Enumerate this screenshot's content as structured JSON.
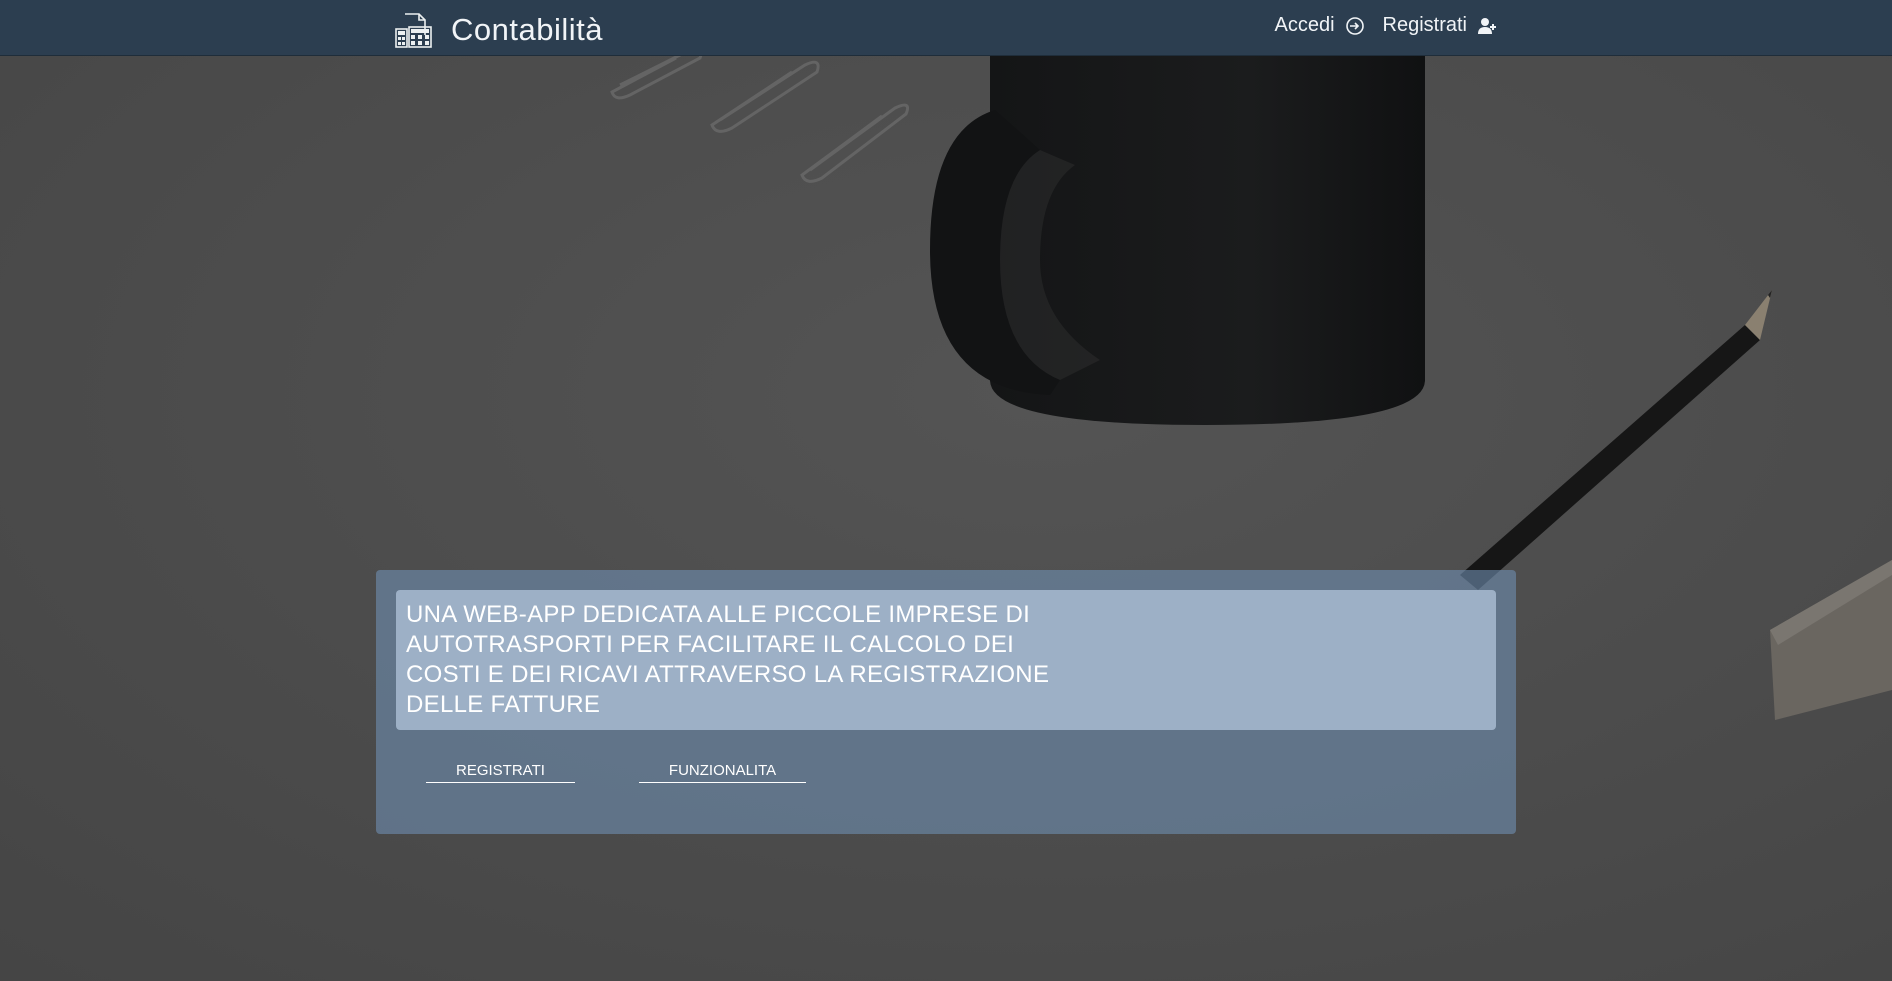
{
  "navbar": {
    "brand_title": "Contabilità",
    "brand_icon": "accounting-documents-icon",
    "links": [
      {
        "label": "Accedi",
        "icon": "login-icon"
      },
      {
        "label": "Registrati",
        "icon": "user-plus-icon"
      }
    ]
  },
  "hero": {
    "tagline": "UNA WEB-APP DEDICATA ALLE PICCOLE IMPRESE DI AUTOTRASPORTI PER FACILITARE IL CALCOLO DEI COSTI E DEI RICAVI ATTRAVERSO LA REGISTRAZIONE DELLE FATTURE",
    "buttons": [
      {
        "label": "REGISTRATI"
      },
      {
        "label": "FUNZIONALITA"
      }
    ]
  },
  "colors": {
    "navbar": "#2c3e50",
    "panel": "#6e8caf",
    "tagline_box": "#b4c8de",
    "text": "#ffffff"
  }
}
